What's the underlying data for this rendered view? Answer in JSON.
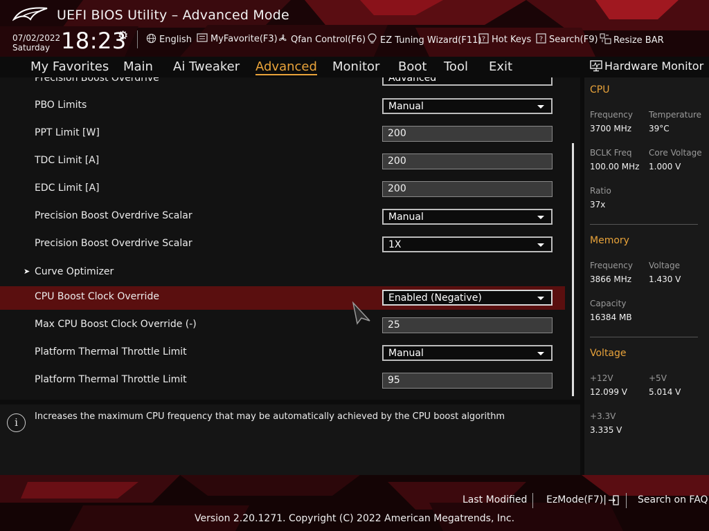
{
  "header": {
    "title": "UEFI BIOS Utility – Advanced Mode",
    "date": "07/02/2022",
    "day": "Saturday",
    "time": "18:23",
    "items": [
      {
        "label": "English",
        "icon": "globe-icon"
      },
      {
        "label": "MyFavorite(F3)",
        "icon": "favorite-list-icon"
      },
      {
        "label": "Qfan Control(F6)",
        "icon": "fan-icon"
      },
      {
        "label": "EZ Tuning Wizard(F11)",
        "icon": "lightbulb-icon"
      },
      {
        "label": "Hot Keys",
        "icon": "question-box-icon"
      },
      {
        "label": "Search(F9)",
        "icon": "question-box-icon"
      },
      {
        "label": "Resize BAR",
        "icon": "resize-bar-icon"
      }
    ]
  },
  "nav": {
    "tabs": [
      "My Favorites",
      "Main",
      "Ai Tweaker",
      "Advanced",
      "Monitor",
      "Boot",
      "Tool",
      "Exit"
    ],
    "active": "Advanced"
  },
  "settings": {
    "partial_top": {
      "label": "Precision Boost Overdrive",
      "value": "Advanced"
    },
    "rows": [
      {
        "label": "PBO Limits",
        "type": "select",
        "value": "Manual"
      },
      {
        "label": "PPT Limit [W]",
        "type": "input",
        "value": "200"
      },
      {
        "label": "TDC Limit [A]",
        "type": "input",
        "value": "200"
      },
      {
        "label": "EDC Limit [A]",
        "type": "input",
        "value": "200"
      },
      {
        "label": "Precision Boost Overdrive Scalar",
        "type": "select",
        "value": "Manual"
      },
      {
        "label": "Precision Boost Overdrive Scalar",
        "type": "select",
        "value": "1X"
      },
      {
        "label": "Curve Optimizer",
        "type": "submenu",
        "value": ""
      },
      {
        "label": "CPU Boost Clock Override",
        "type": "select",
        "value": "Enabled (Negative)",
        "selected": true
      },
      {
        "label": "Max CPU Boost Clock Override (-)",
        "type": "input",
        "value": "25"
      },
      {
        "label": "Platform Thermal Throttle Limit",
        "type": "select",
        "value": "Manual"
      },
      {
        "label": "Platform Thermal Throttle Limit",
        "type": "input",
        "value": "95"
      }
    ]
  },
  "help": {
    "text": "Increases the maximum CPU frequency that may be automatically achieved by the CPU boost algorithm"
  },
  "hardware_monitor": {
    "title": "Hardware Monitor",
    "cpu": {
      "section": "CPU",
      "frequency_label": "Frequency",
      "frequency": "3700 MHz",
      "temperature_label": "Temperature",
      "temperature": "39°C",
      "bclk_label": "BCLK Freq",
      "bclk": "100.00 MHz",
      "core_voltage_label": "Core Voltage",
      "core_voltage": "1.000 V",
      "ratio_label": "Ratio",
      "ratio": "37x"
    },
    "memory": {
      "section": "Memory",
      "frequency_label": "Frequency",
      "frequency": "3866 MHz",
      "voltage_label": "Voltage",
      "voltage": "1.430 V",
      "capacity_label": "Capacity",
      "capacity": "16384 MB"
    },
    "voltage": {
      "section": "Voltage",
      "v12_label": "+12V",
      "v12": "12.099 V",
      "v5_label": "+5V",
      "v5": "5.014 V",
      "v33_label": "+3.3V",
      "v33": "3.335 V"
    }
  },
  "footer": {
    "last_modified": "Last Modified",
    "ezmode": "EzMode(F7)|",
    "search_faq": "Search on FAQ",
    "version": "Version 2.20.1271. Copyright (C) 2022 American Megatrends, Inc."
  },
  "colors": {
    "accent": "#e9a33a",
    "selected_row": "#5a0f0f",
    "brand_red": "#c0141c"
  }
}
